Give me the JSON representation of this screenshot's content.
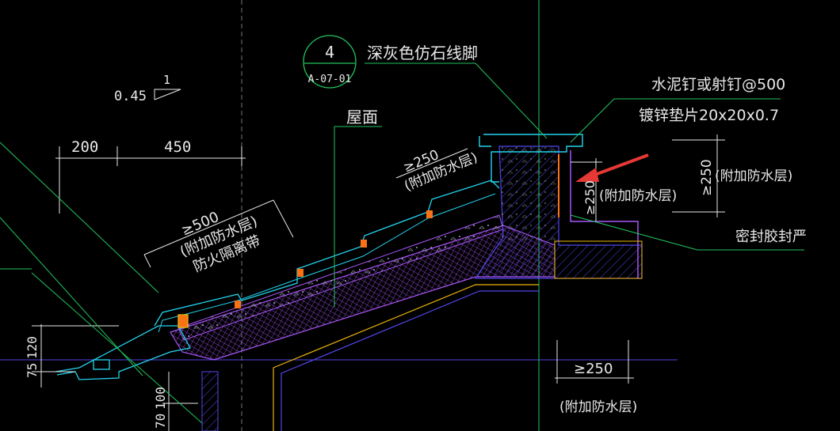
{
  "labels": {
    "detail_number": "4",
    "detail_sheet": "A-07-01",
    "baseboard": "深灰色仿石线脚",
    "nails": "水泥钉或射钉@500",
    "washer": "镀锌垫片20x20x0.7",
    "roof": "屋面",
    "slope_value": "0.45",
    "slope_rise": "1",
    "dim_200": "200",
    "dim_450": "450",
    "ge500": "≥500",
    "extra_wp_1": "(附加防水层)",
    "fire_belt": "防火隔离带",
    "ge250_a": "≥250",
    "extra_wp_2": "(附加防水层)",
    "ge250_b": "≥250",
    "extra_wp_3": "(附加防水层)",
    "ge250_c": "≥250",
    "extra_wp_4": "(附加防水层)",
    "sealant": "密封胶封严",
    "ge250_d": "≥250",
    "extra_wp_5": "(附加防水层)",
    "dim_75": "75",
    "dim_120": "120",
    "dim_70": "70",
    "dim_100": "100"
  },
  "colors": {
    "background": "#000000",
    "leader_green": "#22c55e",
    "text": "#e8e8e8",
    "roof_section": "#a855f7",
    "wall_section": "#4f46e5",
    "tile_outline": "#22d3ee",
    "arrow_red": "#e53935",
    "structure_yellow": "#eab308",
    "detail_circle": "#22c55e"
  }
}
